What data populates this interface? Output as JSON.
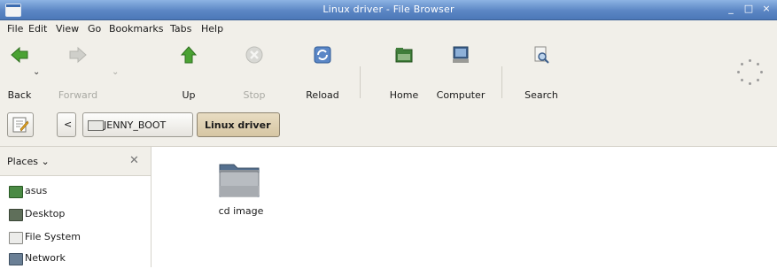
{
  "window": {
    "title": "Linux driver - File Browser",
    "controls": [
      "_",
      "□",
      "×"
    ]
  },
  "menubar": {
    "items": [
      "File",
      "Edit",
      "View",
      "Go",
      "Bookmarks",
      "Tabs",
      "Help"
    ]
  },
  "toolbar": {
    "back": "Back",
    "forward": "Forward",
    "up": "Up",
    "stop": "Stop",
    "reload": "Reload",
    "home": "Home",
    "computer": "Computer",
    "search": "Search"
  },
  "location": {
    "nav_left": "<",
    "crumbs": [
      "JENNY_BOOT",
      "Linux driver"
    ]
  },
  "sidebar": {
    "header": "Places",
    "close": "✕",
    "items": [
      {
        "label": "asus",
        "icon": "home-folder-icon"
      },
      {
        "label": "Desktop",
        "icon": "desktop-icon"
      },
      {
        "label": "File System",
        "icon": "filesystem-icon"
      },
      {
        "label": "Network",
        "icon": "network-icon"
      }
    ]
  },
  "content": {
    "items": [
      {
        "label": "cd image",
        "icon": "folder-icon"
      }
    ]
  },
  "colors": {
    "titlebar": "#5b86c4",
    "chrome": "#f1efe9",
    "accent_green": "#3f9a2c"
  }
}
